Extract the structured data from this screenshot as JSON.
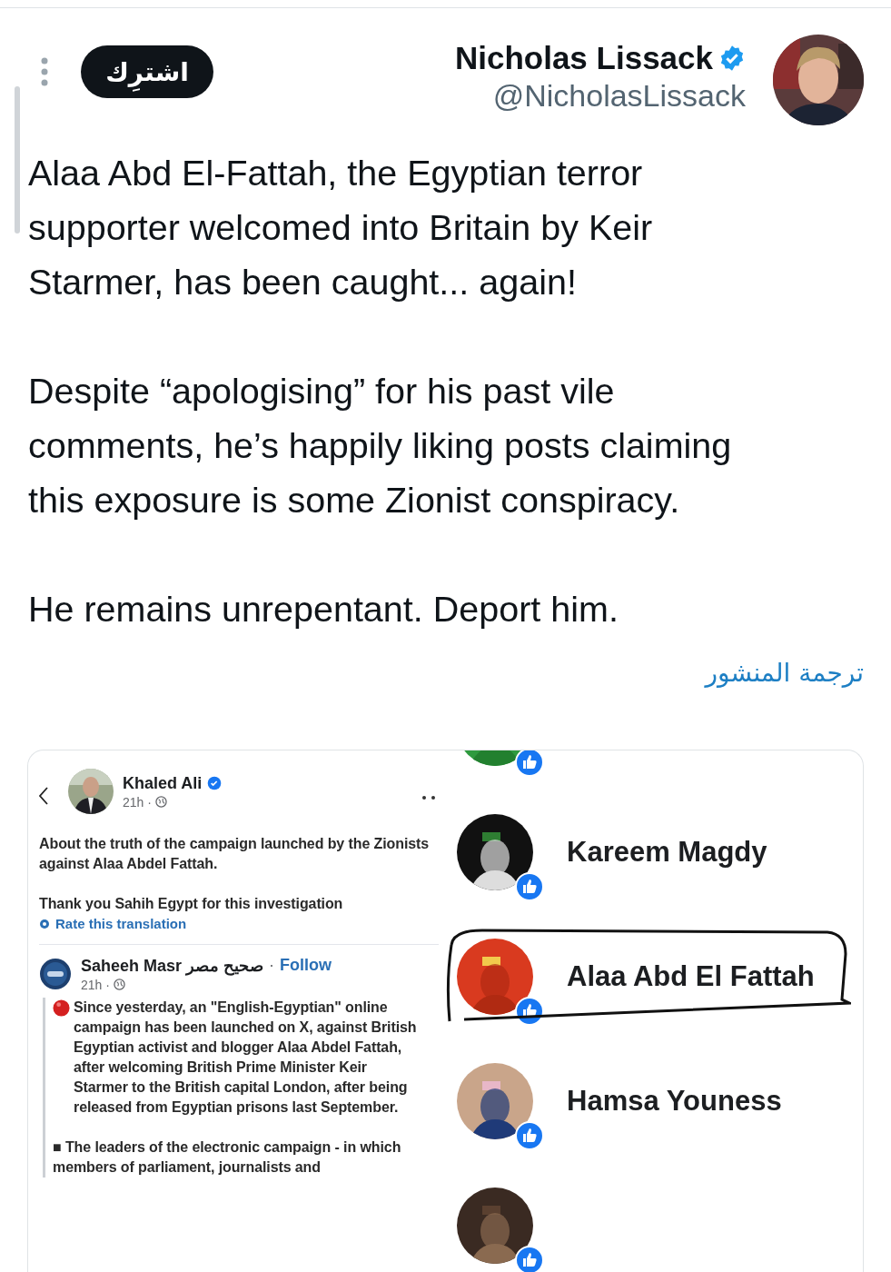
{
  "tweet": {
    "author": {
      "name": "Nicholas Lissack",
      "handle": "@NicholasLissack",
      "verified": true
    },
    "subscribe_button": "اشترِك",
    "paragraphs": [
      "Alaa Abd El-Fattah, the Egyptian terror supporter welcomed into Britain by Keir Starmer, has been caught... again!",
      "Despite “apologising” for his past vile comments, he’s happily liking posts claiming this exposure is some Zionist conspiracy.",
      "He remains unrepentant. Deport him."
    ],
    "translate_link": "ترجمة المنشور"
  },
  "embedded_image": {
    "post": {
      "author": "Khaled Ali",
      "verified": true,
      "time": "21h ·",
      "paragraphs": [
        "About the truth of the campaign launched by the Zionists against Alaa Abdel Fattah.",
        "Thank you Sahih Egypt for this investigation"
      ],
      "rate_link": "Rate this translation",
      "shared": {
        "author": "Saheeh Masr صحيح مصر",
        "separator": "·",
        "follow": "Follow",
        "time": "21h ·",
        "paragraphs": [
          "Since yesterday, an \"English-Egyptian\" online campaign has been launched on X, against British Egyptian activist and blogger Alaa Abdel Fattah, after welcoming British Prime Minister Keir Starmer to the British capital London, after being released from Egyptian prisons last September.",
          "■ The leaders of the electronic campaign - in which members of parliament, journalists and"
        ]
      }
    },
    "likers": [
      {
        "name": "Kareem Magdy",
        "circled": false
      },
      {
        "name": "Alaa Abd El Fattah",
        "circled": true
      },
      {
        "name": "Hamsa Youness",
        "circled": false
      }
    ]
  }
}
